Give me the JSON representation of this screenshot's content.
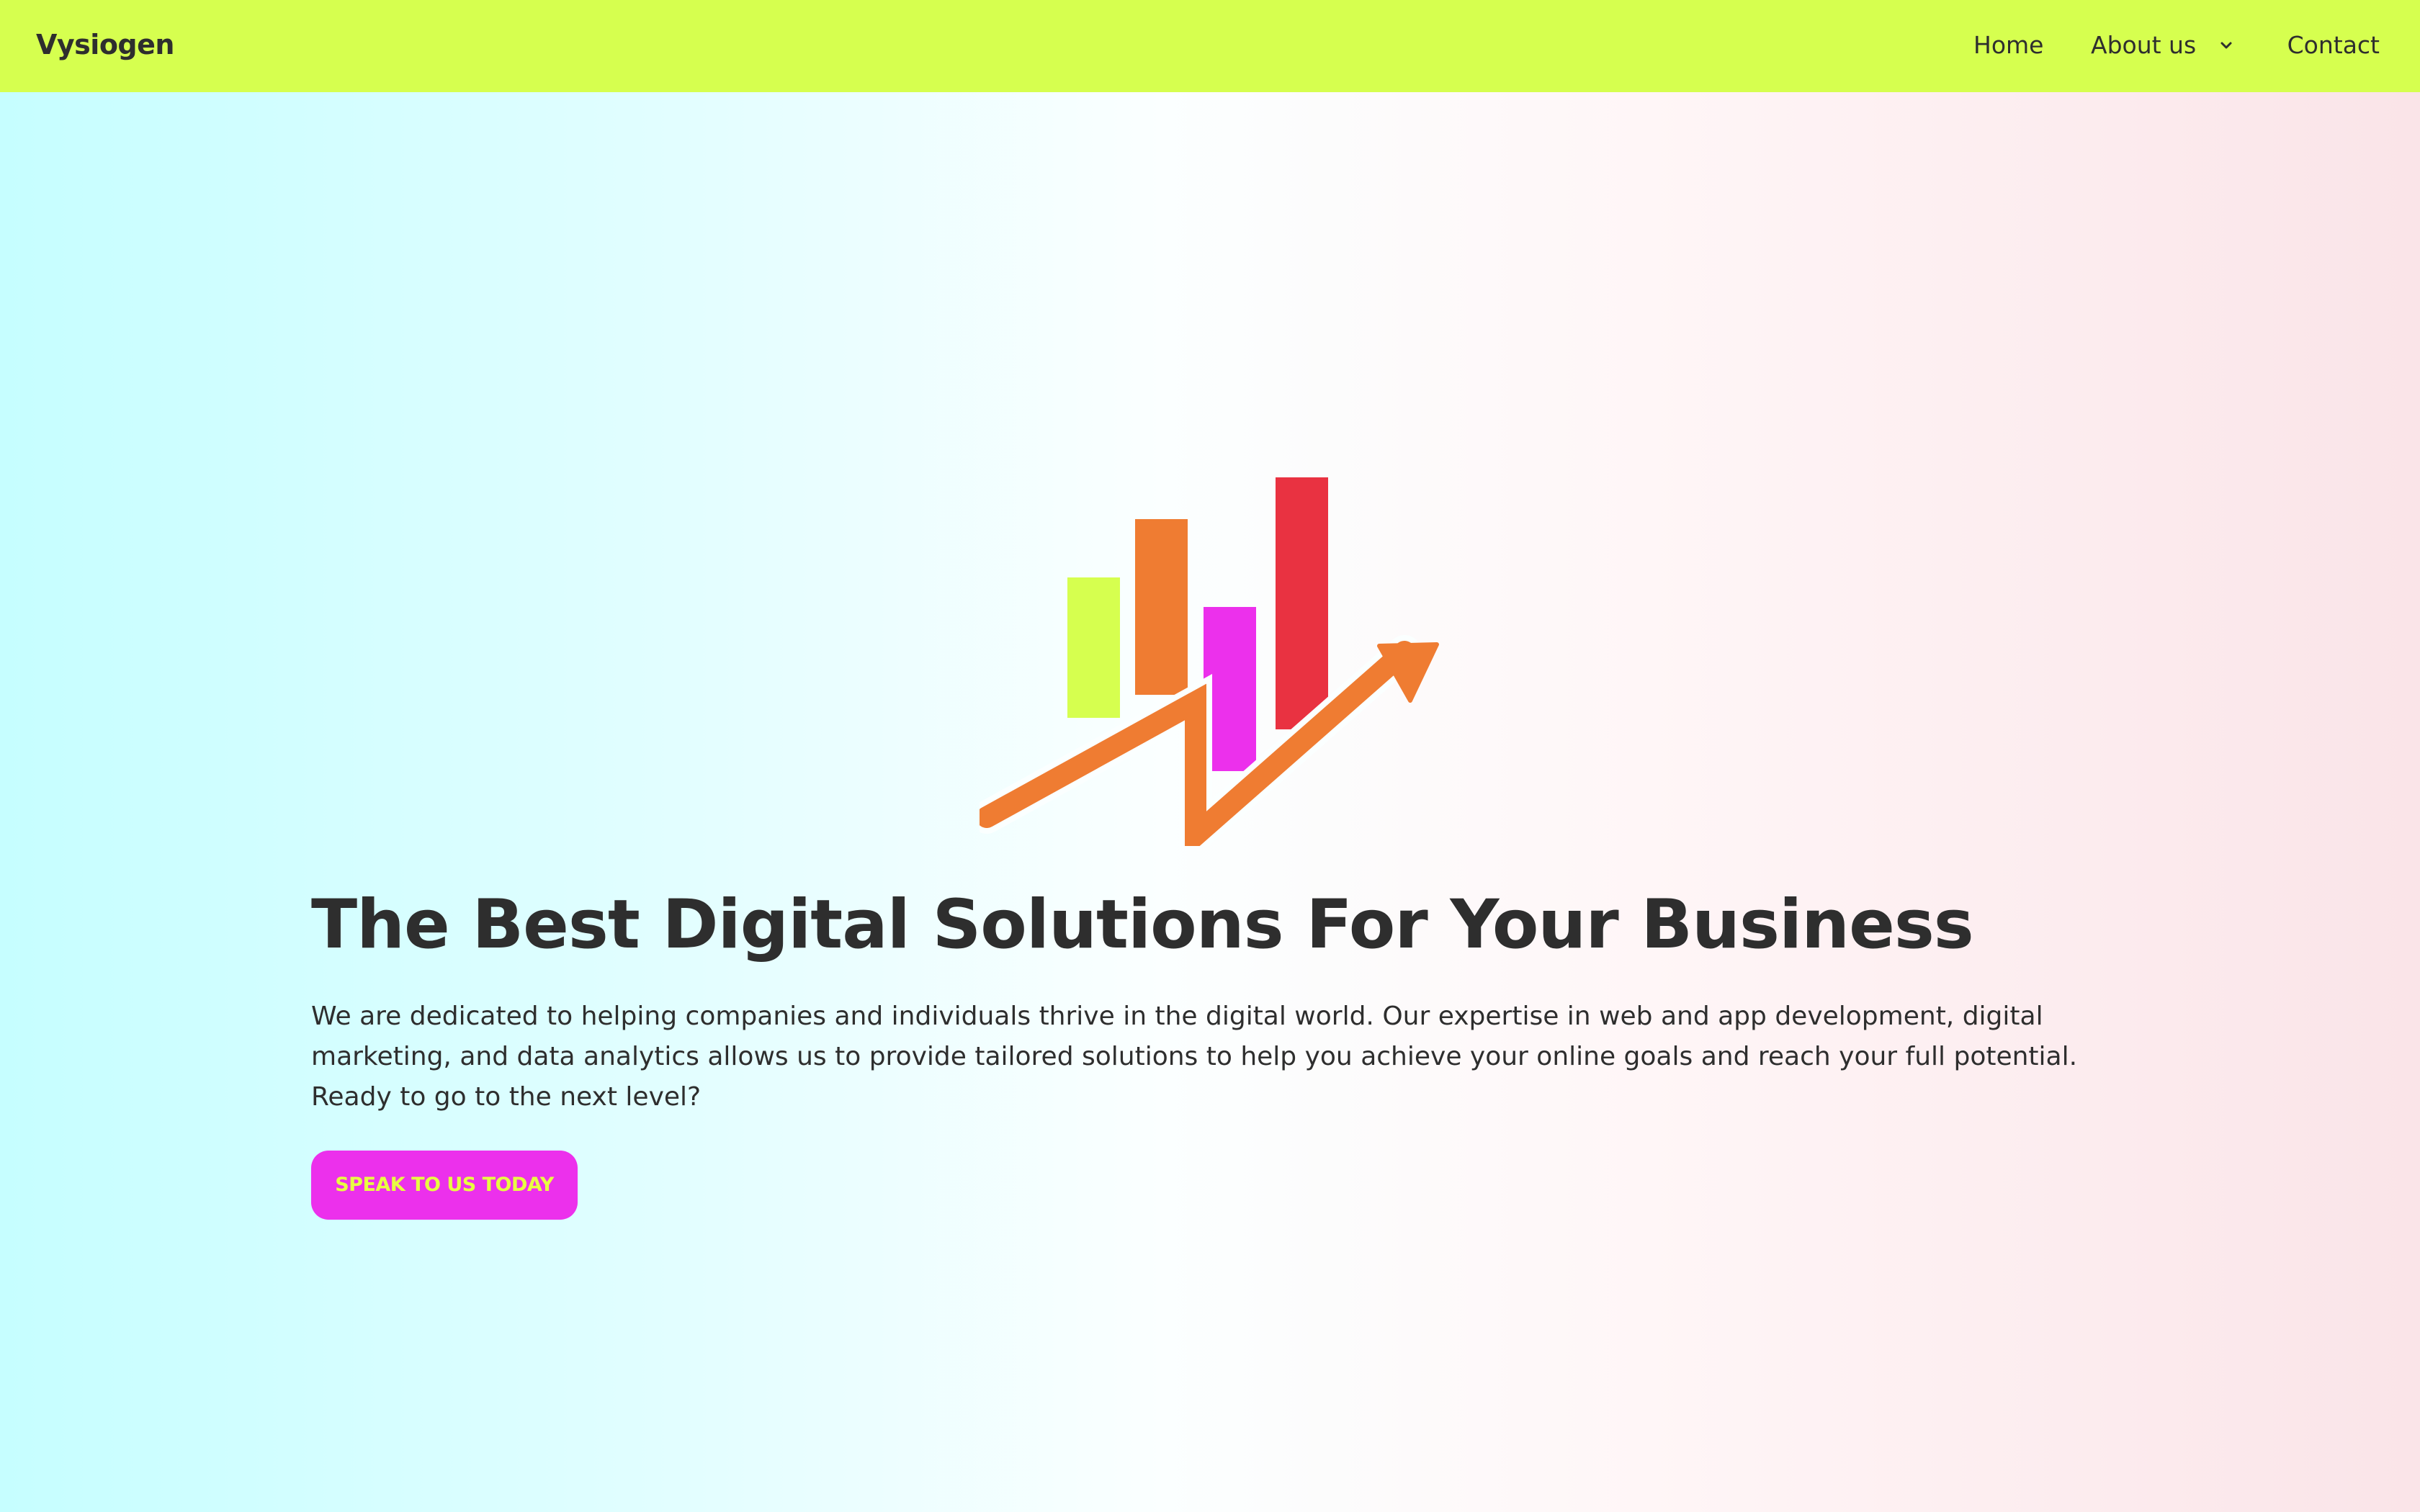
{
  "header": {
    "brand": "Vysiogen",
    "nav": {
      "home": "Home",
      "about": "About us",
      "contact": "Contact"
    }
  },
  "hero": {
    "headline": "The Best Digital Solutions For Your Business",
    "description": "We are dedicated to helping companies and individuals thrive in the digital world. Our expertise in web and app development, digital marketing, and data analytics allows us to provide tailored solutions to help you achieve your online goals and reach your full potential. Ready to go to the next level?",
    "cta_label": "SPEAK TO US TODAY"
  },
  "icons": {
    "dropdown": "chevron-down-icon",
    "logo": "growth-chart-logo"
  },
  "colors": {
    "navbar": "#d6ff4f",
    "text": "#2e2e2e",
    "cta_bg": "#ec30ec",
    "cta_text": "#e8ff42",
    "logo_bar_1": "#d6ff4f",
    "logo_bar_2": "#ef7c32",
    "logo_bar_3": "#ec30ec",
    "logo_bar_4": "#e93241",
    "logo_arrow": "#ef7c32"
  }
}
